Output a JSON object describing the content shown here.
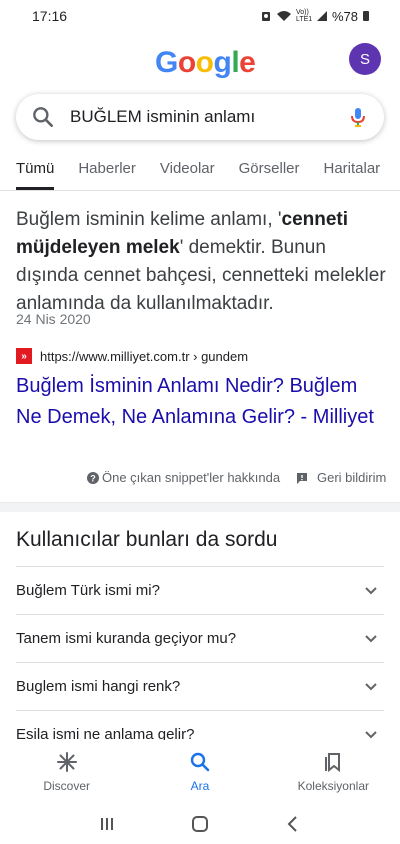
{
  "status": {
    "time": "17:16",
    "network": "Vo)) LTE1",
    "battery": "%78"
  },
  "header": {
    "logo_letters": [
      "G",
      "o",
      "o",
      "g",
      "l",
      "e"
    ],
    "avatar_initial": "S"
  },
  "search": {
    "query": "BUĞLEM isminin anlamı",
    "icon": "search-icon",
    "mic_icon": "mic-icon"
  },
  "tabs": [
    {
      "label": "Tümü",
      "active": true
    },
    {
      "label": "Haberler"
    },
    {
      "label": "Videolar"
    },
    {
      "label": "Görseller"
    },
    {
      "label": "Haritalar"
    }
  ],
  "featured": {
    "text_before": "Buğlem isminin kelime anlamı, '",
    "text_bold": "cenneti müjdeleyen melek",
    "text_after": "' demektir. Bunun dışında cennet bahçesi, cennetteki melekler anlamında da kullanılmaktadır.",
    "date": "24 Nis 2020",
    "source_url": "https://www.milliyet.com.tr › gundem",
    "favicon_glyph": "»",
    "link_title": "Buğlem İsminin Anlamı Nedir? Buğlem Ne Demek, Ne Anlamına Gelir? - Milliyet",
    "about_label": "Öne çıkan snippet'ler hakkında",
    "feedback_label": "Geri bildirim"
  },
  "paa": {
    "title": "Kullanıcılar bunları da sordu",
    "questions": [
      "Buğlem Türk ismi mi?",
      "Tanem ismi kuranda geçiyor mu?",
      "Buglem ismi hangi renk?",
      "Esila ismi ne anlama gelir?"
    ]
  },
  "bottom_nav": [
    {
      "label": "Discover",
      "icon": "asterisk-icon"
    },
    {
      "label": "Ara",
      "icon": "search-icon",
      "active": true
    },
    {
      "label": "Koleksiyonlar",
      "icon": "collections-icon"
    }
  ],
  "colors": {
    "link": "#1a0dab",
    "accent": "#1a73e8",
    "avatar": "#5e35b1"
  }
}
